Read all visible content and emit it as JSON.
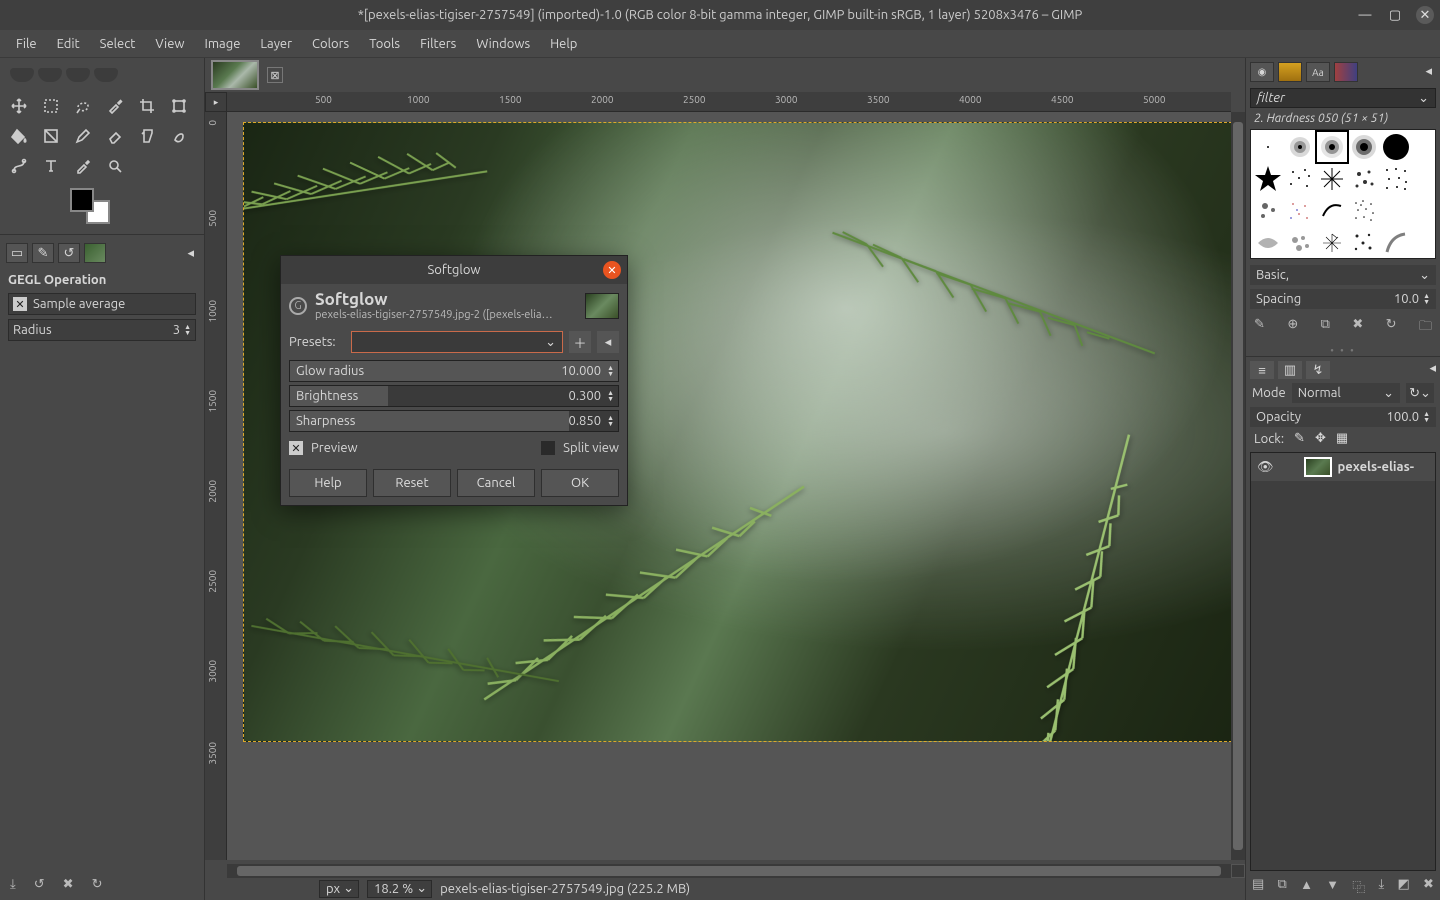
{
  "window": {
    "title": "*[pexels-elias-tigiser-2757549] (imported)-1.0 (RGB color 8-bit gamma integer, GIMP built-in sRGB, 1 layer) 5208x3476 – GIMP"
  },
  "menu": [
    "File",
    "Edit",
    "Select",
    "View",
    "Image",
    "Layer",
    "Colors",
    "Tools",
    "Filters",
    "Windows",
    "Help"
  ],
  "tool_options": {
    "heading": "GEGL Operation",
    "sample_average": "Sample average",
    "radius_label": "Radius",
    "radius_value": "3"
  },
  "ruler_h": [
    "500",
    "1000",
    "1500",
    "2000",
    "2500",
    "3000",
    "3500",
    "4000",
    "4500",
    "5000"
  ],
  "ruler_v": [
    "0",
    "500",
    "1000",
    "1500",
    "2000",
    "2500",
    "3000",
    "3500"
  ],
  "status": {
    "unit": "px",
    "zoom": "18.2 %",
    "text": "pexels-elias-tigiser-2757549.jpg (225.2 MB)"
  },
  "brushes": {
    "filter_placeholder": "filter",
    "current": "2. Hardness 050 (51 × 51)",
    "preset_group": "Basic,",
    "spacing_label": "Spacing",
    "spacing_value": "10.0"
  },
  "layers": {
    "mode_label": "Mode",
    "mode_value": "Normal",
    "opacity_label": "Opacity",
    "opacity_value": "100.0",
    "lock_label": "Lock:",
    "items": [
      {
        "name": "pexels-elias-"
      }
    ]
  },
  "dialog": {
    "title": "Softglow",
    "heading": "Softglow",
    "subheading": "pexels-elias-tigiser-2757549.jpg-2 ([pexels-elias-tig…",
    "presets_label": "Presets:",
    "params": [
      {
        "label": "Glow radius",
        "value": "10.000",
        "fill": 100
      },
      {
        "label": "Brightness",
        "value": "0.300",
        "fill": 30
      },
      {
        "label": "Sharpness",
        "value": "0.850",
        "fill": 85
      }
    ],
    "preview_label": "Preview",
    "split_label": "Split view",
    "buttons": {
      "help": "Help",
      "reset": "Reset",
      "cancel": "Cancel",
      "ok": "OK"
    }
  }
}
